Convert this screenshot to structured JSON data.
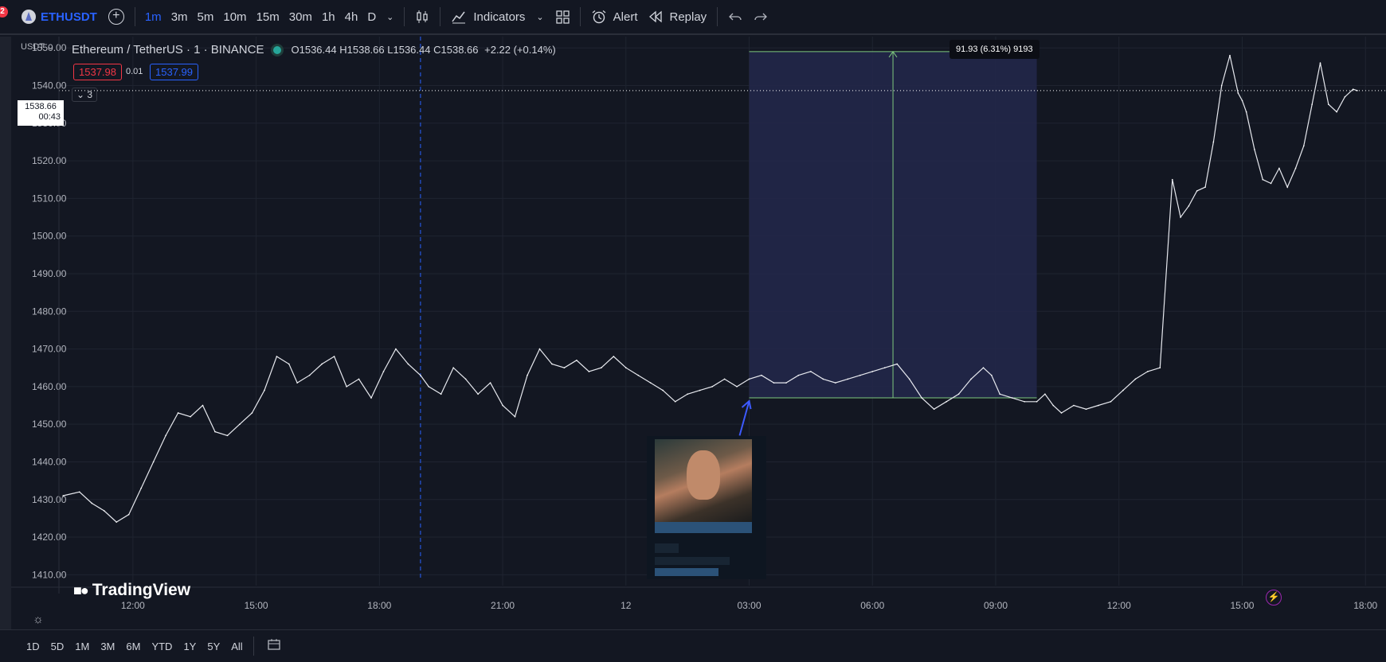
{
  "toolbar": {
    "notification_count": "2",
    "symbol": "ETHUSDT",
    "intervals": [
      {
        "label": "1m",
        "active": true
      },
      {
        "label": "3m",
        "active": false
      },
      {
        "label": "5m",
        "active": false
      },
      {
        "label": "10m",
        "active": false
      },
      {
        "label": "15m",
        "active": false
      },
      {
        "label": "30m",
        "active": false
      },
      {
        "label": "1h",
        "active": false
      },
      {
        "label": "4h",
        "active": false
      },
      {
        "label": "D",
        "active": false
      }
    ],
    "indicators_label": "Indicators",
    "alert_label": "Alert",
    "replay_label": "Replay"
  },
  "legend": {
    "title": "Ethereum / TetherUS · 1 · BINANCE",
    "open_label": "O",
    "open": "1536.44",
    "high_label": "H",
    "high": "1538.66",
    "low_label": "L",
    "low": "1536.44",
    "close_label": "C",
    "close": "1538.66",
    "change": "+2.22 (+0.14%)",
    "sell_price": "1537.98",
    "spread": "0.01",
    "buy_price": "1537.99",
    "collapsed_count": "3",
    "currency": "USDT"
  },
  "price_tag": {
    "price": "1538.66",
    "countdown": "00:43"
  },
  "measure": {
    "label": "91.93 (6.31%) 9193"
  },
  "watermark": "TradingView",
  "bottom": {
    "ranges": [
      "1D",
      "5D",
      "1M",
      "3M",
      "6M",
      "YTD",
      "1Y",
      "5Y",
      "All"
    ]
  },
  "colors": {
    "background": "#131722",
    "grid": "#1f2430",
    "accent": "#2962ff",
    "measure_fill": "#222749",
    "measure_line": "#7ec87e",
    "price_line": "#ffffff"
  },
  "chart_data": {
    "type": "line",
    "ylim": [
      1405,
      1553
    ],
    "y_ticks": [
      "1550.00",
      "1540.00",
      "1530.00",
      "1520.00",
      "1510.00",
      "1500.00",
      "1490.00",
      "1480.00",
      "1470.00",
      "1460.00",
      "1450.00",
      "1440.00",
      "1430.00",
      "1420.00",
      "1410.00"
    ],
    "y_tick_values": [
      1550,
      1540,
      1530,
      1520,
      1510,
      1500,
      1490,
      1480,
      1470,
      1460,
      1450,
      1440,
      1430,
      1420,
      1410
    ],
    "x_tick_labels": [
      "12:00",
      "15:00",
      "18:00",
      "21:00",
      "12",
      "03:00",
      "06:00",
      "09:00",
      "12:00",
      "15:00",
      "18:00"
    ],
    "x_tick_hours": [
      12,
      15,
      18,
      21,
      24,
      27,
      30,
      33,
      36,
      39,
      42
    ],
    "xlim_hours": [
      10.2,
      42.5
    ],
    "series": [
      {
        "hours": [
          10.3,
          10.7,
          11.0,
          11.3,
          11.6,
          11.9,
          12.2,
          12.5,
          12.8,
          13.1,
          13.4,
          13.7,
          14.0,
          14.3,
          14.6,
          14.9,
          15.2,
          15.5,
          15.8,
          16.0,
          16.3,
          16.6,
          16.9,
          17.2,
          17.5,
          17.8,
          18.1,
          18.4,
          18.7,
          19.0,
          19.2,
          19.5,
          19.8,
          20.1,
          20.4,
          20.7,
          21.0,
          21.3,
          21.6,
          21.9,
          22.2,
          22.5,
          22.8,
          23.1,
          23.4,
          23.7,
          24.0,
          24.3,
          24.6,
          24.9,
          25.2,
          25.5,
          25.8,
          26.1,
          26.4,
          26.7,
          27.0,
          27.3,
          27.6,
          27.9,
          28.2,
          28.5,
          28.8,
          29.1,
          29.4,
          29.7,
          30.0,
          30.3,
          30.6,
          30.9,
          31.2,
          31.5,
          31.8,
          32.1,
          32.4,
          32.7,
          32.9,
          33.1,
          33.4,
          33.7,
          34.0,
          34.2,
          34.4,
          34.6,
          34.9,
          35.2,
          35.5,
          35.8,
          36.1,
          36.4,
          36.7,
          37.0,
          37.3,
          37.5,
          37.7,
          37.9,
          38.1,
          38.3,
          38.5,
          38.7,
          38.9,
          39.0,
          39.1,
          39.3,
          39.5,
          39.7,
          39.9,
          40.1,
          40.3,
          40.5,
          40.7,
          40.9,
          41.1,
          41.3,
          41.5,
          41.7,
          41.8
        ],
        "values": [
          1431,
          1432,
          1429,
          1427,
          1424,
          1426,
          1433,
          1440,
          1447,
          1453,
          1452,
          1455,
          1448,
          1447,
          1450,
          1453,
          1459,
          1468,
          1466,
          1461,
          1463,
          1466,
          1468,
          1460,
          1462,
          1457,
          1464,
          1470,
          1466,
          1463,
          1460,
          1458,
          1465,
          1462,
          1458,
          1461,
          1455,
          1452,
          1463,
          1470,
          1466,
          1465,
          1467,
          1464,
          1465,
          1468,
          1465,
          1463,
          1461,
          1459,
          1456,
          1458,
          1459,
          1460,
          1462,
          1460,
          1462,
          1463,
          1461,
          1461,
          1463,
          1464,
          1462,
          1461,
          1462,
          1463,
          1464,
          1465,
          1466,
          1462,
          1457,
          1454,
          1456,
          1458,
          1462,
          1465,
          1463,
          1458,
          1457,
          1456,
          1456,
          1458,
          1455,
          1453,
          1455,
          1454,
          1455,
          1456,
          1459,
          1462,
          1464,
          1465,
          1515,
          1505,
          1508,
          1512,
          1513,
          1525,
          1540,
          1548,
          1538,
          1536,
          1533,
          1523,
          1515,
          1514,
          1518,
          1513,
          1518,
          1524,
          1535,
          1546,
          1535,
          1533,
          1537,
          1539,
          1538.66
        ]
      }
    ],
    "current_price": 1538.66,
    "measure_range": {
      "from_hour": 27.0,
      "to_hour": 34.0,
      "low": 1457.0,
      "high": 1549.0
    },
    "vertical_marker_hour": 19.0
  }
}
